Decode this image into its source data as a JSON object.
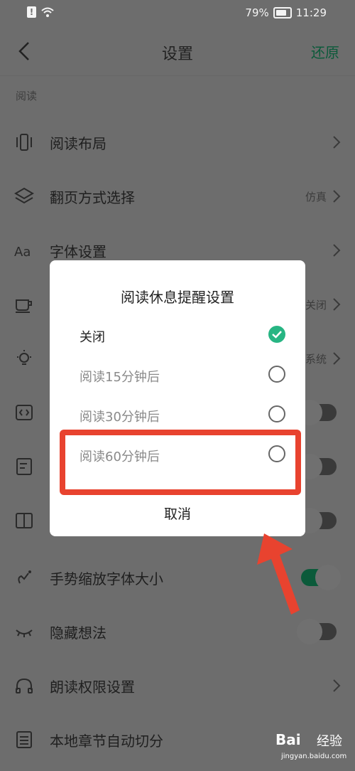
{
  "status_bar": {
    "battery": "79%",
    "time": "11:29",
    "alert": "!"
  },
  "header": {
    "title": "设置",
    "restore": "还原"
  },
  "section": {
    "label": "阅读"
  },
  "rows": [
    {
      "label": "阅读布局",
      "icon": "layout-icon",
      "value": ""
    },
    {
      "label": "翻页方式选择",
      "icon": "layers-icon",
      "value": "仿真"
    },
    {
      "label": "字体设置",
      "icon": "font-icon",
      "value": ""
    },
    {
      "label": "",
      "icon": "cup-icon",
      "value": "关闭"
    },
    {
      "label": "",
      "icon": "bulb-icon",
      "value": "系统"
    },
    {
      "label": "",
      "icon": "code-icon",
      "value": ""
    },
    {
      "label": "",
      "icon": "note-icon",
      "value": ""
    },
    {
      "label": "",
      "icon": "book-icon",
      "value": ""
    },
    {
      "label": "手势缩放字体大小",
      "icon": "gesture-icon",
      "value": ""
    },
    {
      "label": "隐藏想法",
      "icon": "eye-closed-icon",
      "value": ""
    },
    {
      "label": "朗读权限设置",
      "icon": "headphone-icon",
      "value": ""
    },
    {
      "label": "本地章节自动切分",
      "icon": "list-icon",
      "value": ""
    }
  ],
  "dialog": {
    "title": "阅读休息提醒设置",
    "options": [
      {
        "label": "关闭",
        "selected": true
      },
      {
        "label": "阅读15分钟后",
        "selected": false
      },
      {
        "label": "阅读30分钟后",
        "selected": false
      },
      {
        "label": "阅读60分钟后",
        "selected": false
      }
    ],
    "cancel": "取消"
  },
  "watermark": {
    "brand": "Bai",
    "brand2": "经验",
    "site": "jingyan.baidu.com"
  },
  "colors": {
    "accent": "#27b583",
    "brand_green": "#0b5a3a",
    "highlight": "#e8432f"
  }
}
